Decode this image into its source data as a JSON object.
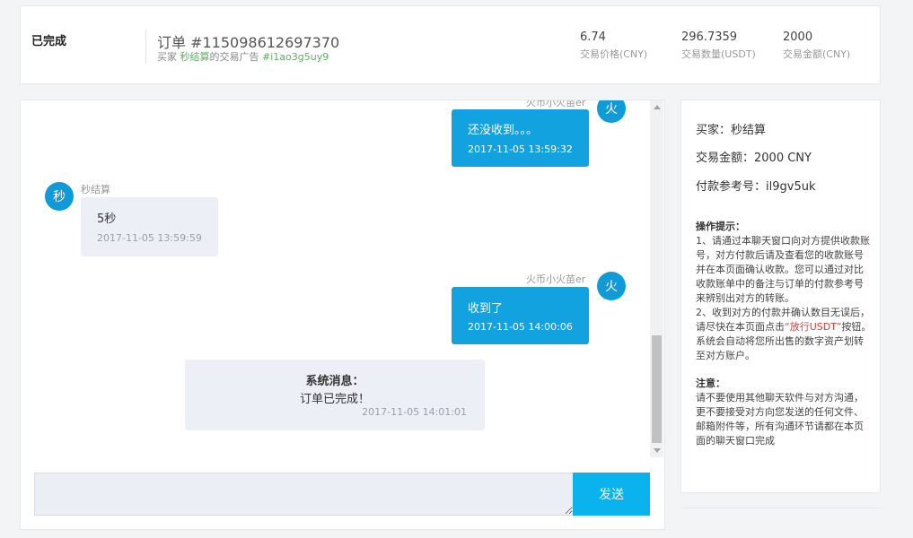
{
  "order": {
    "status": "已完成",
    "number": "订单 #115098612697370",
    "sub_prefix": "买家 ",
    "sub_buyer": "秒结算",
    "sub_middle": "的交易广告 ",
    "sub_ad_id": "#i1ao3g5uy9",
    "stats": [
      {
        "value": "6.74",
        "label": "交易价格(CNY)"
      },
      {
        "value": "296.7359",
        "label": "交易数量(USDT)"
      },
      {
        "value": "2000",
        "label": "交易金额(CNY)"
      }
    ]
  },
  "chat": {
    "messages": [
      {
        "sender": "火币小火苗er",
        "avatar": "火",
        "text": "还没收到。。。",
        "time": "2017-11-05 13:59:32"
      },
      {
        "sender": "秒结算",
        "avatar": "秒",
        "text": "5秒",
        "time": "2017-11-05 13:59:59"
      },
      {
        "sender": "火币小火苗er",
        "avatar": "火",
        "text": "收到了",
        "time": "2017-11-05 14:00:06"
      }
    ],
    "system": {
      "title": "系统消息：",
      "body": "订单已完成！",
      "time": "2017-11-05 14:01:01"
    },
    "input_value": "",
    "send_label": "发送"
  },
  "info": {
    "buyer": "买家：秒结算",
    "amount": "交易金额：2000 CNY",
    "ref": "付款参考号：il9gv5uk",
    "tips_title": "操作提示：",
    "tip1": "1、请通过本聊天窗口向对方提供收款账号，对方付款后请及查看您的收款账号并在本页面确认收款。您可以通过对比收款账单中的备注与订单的付款参考号来辨别出对方的转账。",
    "tip2_a": "2、收到对方的付款并确认数目无误后，请尽快在本页面点击",
    "tip2_red": "“放行USDT”",
    "tip2_b": "按钮。系统会自动将您所出售的数字资产划转至对方账户。",
    "note_title": "注意：",
    "note": "请不要使用其他聊天软件与对方沟通，更不要接受对方向您发送的任何文件、邮箱附件等，所有沟通环节请都在本页面的聊天窗口完成"
  }
}
